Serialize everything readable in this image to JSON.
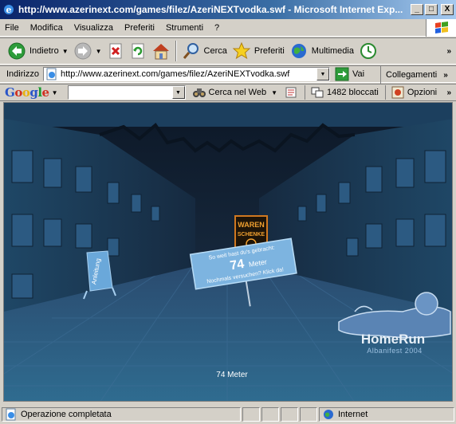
{
  "window": {
    "title": "http://www.azerinext.com/games/filez/AzeriNEXTvodka.swf - Microsoft Internet Exp...",
    "buttons": {
      "minimize": "_",
      "maximize": "□",
      "close": "X"
    }
  },
  "menu": {
    "items": [
      {
        "label": "File"
      },
      {
        "label": "Modifica"
      },
      {
        "label": "Visualizza"
      },
      {
        "label": "Preferiti"
      },
      {
        "label": "Strumenti"
      },
      {
        "label": "?"
      }
    ]
  },
  "toolbar": {
    "back_label": "Indietro",
    "search_label": "Cerca",
    "favorites_label": "Preferiti",
    "media_label": "Multimedia",
    "overflow": "»"
  },
  "address": {
    "label": "Indirizzo",
    "url": "http://www.azerinext.com/games/filez/AzeriNEXTvodka.swf",
    "go_label": "Vai",
    "links_label": "Collegamenti",
    "links_overflow": "»"
  },
  "google": {
    "logo": "Google",
    "search_web_label": "Cerca nel Web",
    "blocked_label": "1482 bloccati",
    "options_label": "Opzioni",
    "overflow": "»"
  },
  "game": {
    "sign_brand_top": "WAREN",
    "sign_brand_bottom": "SCHENKE",
    "result_line1": "So weit hast du's gebracht:",
    "result_value": "74",
    "result_unit": "Meter",
    "result_line3": "Nochmals versuchen? Klick da!",
    "help_sign": "Anleitung",
    "logo_title": "HomeRun",
    "logo_subtitle": "Albanifest 2004",
    "distance_readout": "74 Meter"
  },
  "status": {
    "message": "Operazione completata",
    "zone": "Internet"
  }
}
